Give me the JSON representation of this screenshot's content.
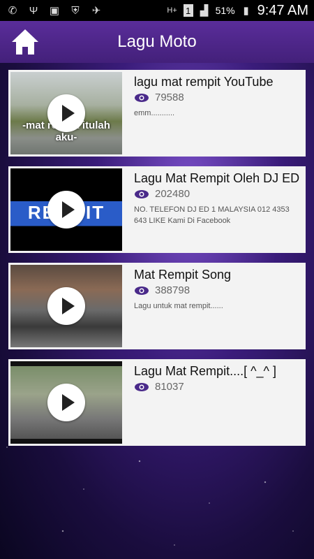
{
  "status_bar": {
    "battery_percent": "51%",
    "time": "9:47 AM",
    "sim": "1",
    "network": "H+"
  },
  "app_bar": {
    "title": "Lagu Moto",
    "home_icon": "home-icon"
  },
  "videos": [
    {
      "title": "lagu mat rempit YouTube",
      "views": "79588",
      "description": "emm...........",
      "thumb_text": "-mat rempit itulah aku-"
    },
    {
      "title": "Lagu Mat Rempit Oleh DJ ED",
      "views": "202480",
      "description": "NO. TELEFON DJ ED 1 MALAYSIA 012 4353 643 LIKE Kami Di Facebook",
      "thumb_text": "REMPIT"
    },
    {
      "title": "Mat Rempit Song",
      "views": "388798",
      "description": "Lagu untuk mat rempit......",
      "thumb_text": ""
    },
    {
      "title": "Lagu Mat Rempit....[ ^_^ ]",
      "views": "81037",
      "description": "",
      "thumb_text": ""
    }
  ],
  "colors": {
    "accent": "#4a2a8a",
    "app_bar": "#4b2385"
  }
}
